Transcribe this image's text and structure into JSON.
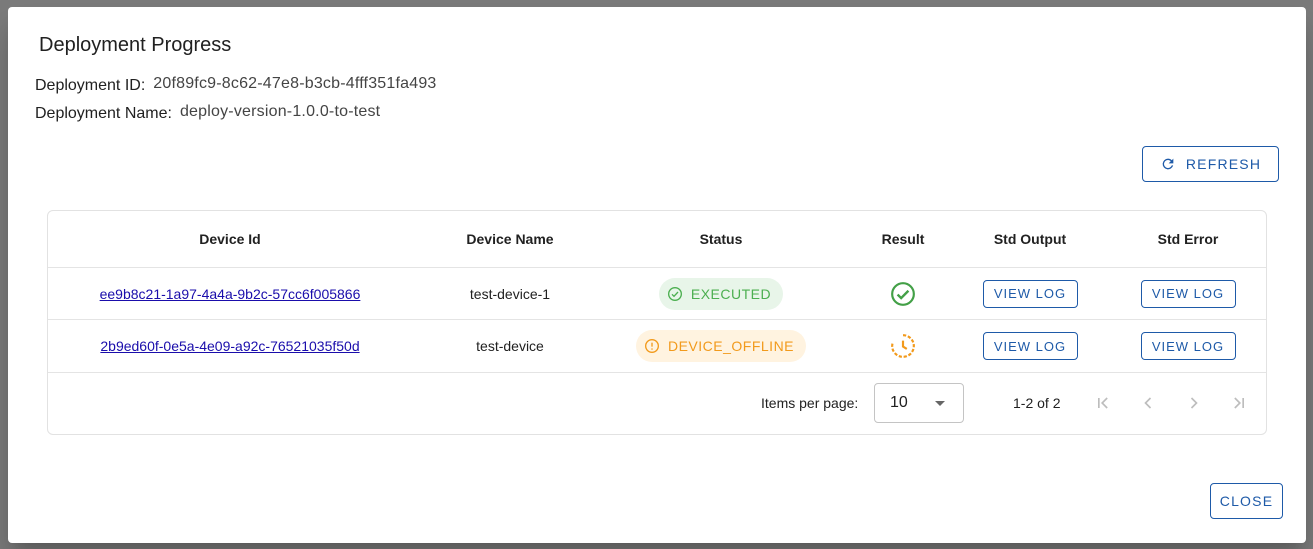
{
  "dialog": {
    "title": "Deployment Progress",
    "deployment_id_label": "Deployment ID:",
    "deployment_id": "20f89fc9-8c62-47e8-b3cb-4fff351fa493",
    "deployment_name_label": "Deployment Name:",
    "deployment_name": "deploy-version-1.0.0-to-test",
    "refresh_label": "REFRESH",
    "close_label": "CLOSE"
  },
  "table": {
    "headers": [
      "Device Id",
      "Device Name",
      "Status",
      "Result",
      "Std Output",
      "Std Error"
    ],
    "rows": [
      {
        "device_id": "ee9b8c21-1a97-4a4a-9b2c-57cc6f005866",
        "device_name": "test-device-1",
        "status": "EXECUTED",
        "result_icon": "check-circle-icon",
        "std_output_label": "VIEW LOG",
        "std_error_label": "VIEW LOG"
      },
      {
        "device_id": "2b9ed60f-0e5a-4e09-a92c-76521035f50d",
        "device_name": "test-device",
        "status": "DEVICE_OFFLINE",
        "result_icon": "pending-clock-icon",
        "std_output_label": "VIEW LOG",
        "std_error_label": "VIEW LOG"
      }
    ]
  },
  "pagination": {
    "items_per_page_label": "Items per page:",
    "items_per_page": "10",
    "range": "1-2 of 2"
  },
  "colors": {
    "accent": "#1e5aa8",
    "success": "#4caf50",
    "warning": "#f29a1c"
  }
}
